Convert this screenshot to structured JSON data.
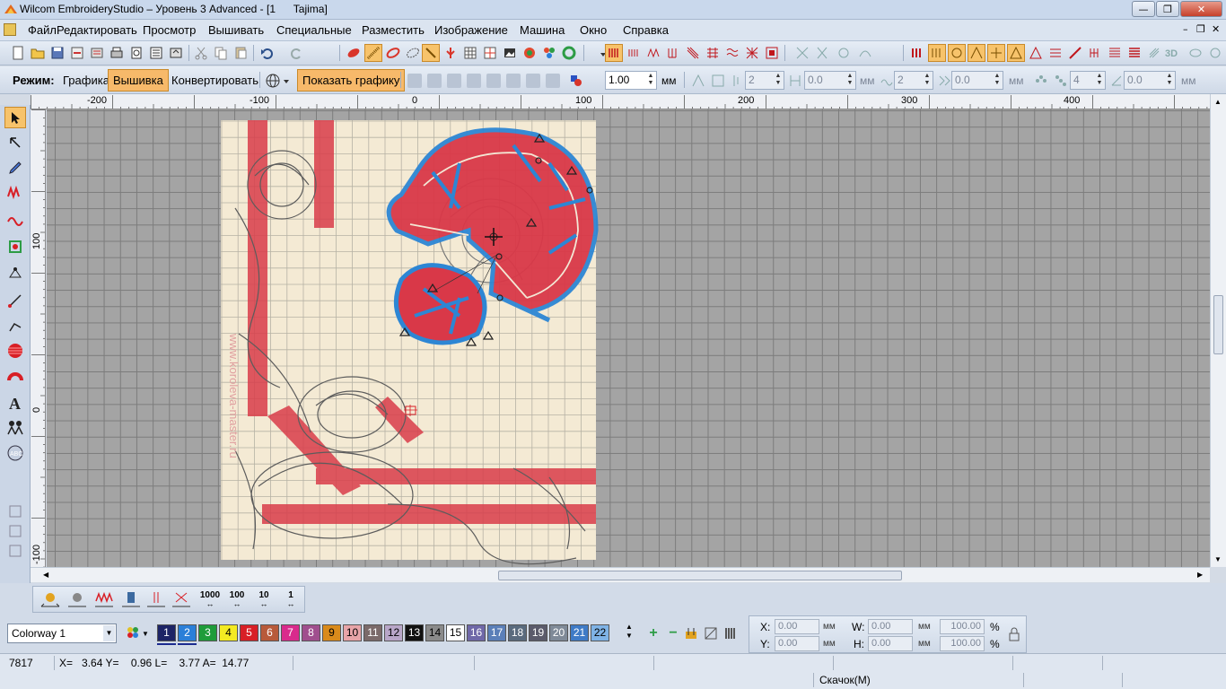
{
  "window": {
    "title": "Wilcom EmbroideryStudio – Уровень 3 Advanced - [1      Tajima]",
    "controls": {
      "minimize": "—",
      "maximize": "❐",
      "close": "✕"
    }
  },
  "menu": {
    "items": [
      "Файл",
      "Редактировать",
      "Просмотр",
      "Вышивать",
      "Специальные",
      "Разместить",
      "Изображение",
      "Машина",
      "Окно",
      "Справка"
    ],
    "mdi_controls": {
      "minimize": "–",
      "restore": "❐",
      "close": "✕"
    }
  },
  "mode_bar": {
    "label": "Режим:",
    "modes": [
      "Графика",
      "Вышивка",
      "Конвертировать"
    ],
    "active_mode": "Вышивка",
    "show_graphics_button": "Показать графику",
    "scale_value": "1.00",
    "scale_unit": "мм",
    "fields": [
      {
        "value": "2",
        "unit": ""
      },
      {
        "value": "0.0",
        "unit": "мм"
      },
      {
        "value": "2",
        "unit": ""
      },
      {
        "value": "0.0",
        "unit": "мм"
      },
      {
        "value": "4",
        "unit": ""
      },
      {
        "value": "0.0",
        "unit": "мм"
      }
    ]
  },
  "ruler": {
    "top_labels": [
      "-200",
      "-100",
      "0",
      "100",
      "200",
      "300",
      "400"
    ],
    "left_labels": [
      "100",
      "0",
      "-100"
    ]
  },
  "stitch_toolbar": {
    "numeric_buttons": [
      "1000",
      "100",
      "10",
      "1"
    ]
  },
  "colorway": {
    "selected": "Colorway 1",
    "swatches": [
      {
        "n": "1",
        "bg": "#1d2466",
        "fg": "#ffffff"
      },
      {
        "n": "2",
        "bg": "#2b7fd8",
        "fg": "#ffffff"
      },
      {
        "n": "3",
        "bg": "#1f9c3a",
        "fg": "#ffffff"
      },
      {
        "n": "4",
        "bg": "#f3ea22",
        "fg": "#000000"
      },
      {
        "n": "5",
        "bg": "#d81f26",
        "fg": "#ffffff"
      },
      {
        "n": "6",
        "bg": "#b85a3a",
        "fg": "#ffffff"
      },
      {
        "n": "7",
        "bg": "#d92a8c",
        "fg": "#ffffff"
      },
      {
        "n": "8",
        "bg": "#a04e8e",
        "fg": "#ffffff"
      },
      {
        "n": "9",
        "bg": "#d98a1b",
        "fg": "#000000"
      },
      {
        "n": "10",
        "bg": "#e7a4a8",
        "fg": "#000000"
      },
      {
        "n": "11",
        "bg": "#7b6a6a",
        "fg": "#ffffff"
      },
      {
        "n": "12",
        "bg": "#b8a6c8",
        "fg": "#000000"
      },
      {
        "n": "13",
        "bg": "#111111",
        "fg": "#ffffff"
      },
      {
        "n": "14",
        "bg": "#8a8a8a",
        "fg": "#000000"
      },
      {
        "n": "15",
        "bg": "#ffffff",
        "fg": "#000000"
      },
      {
        "n": "16",
        "bg": "#6f68a8",
        "fg": "#ffffff"
      },
      {
        "n": "17",
        "bg": "#5b7fb8",
        "fg": "#ffffff"
      },
      {
        "n": "18",
        "bg": "#5a6b7e",
        "fg": "#ffffff"
      },
      {
        "n": "19",
        "bg": "#5b5b6b",
        "fg": "#ffffff"
      },
      {
        "n": "20",
        "bg": "#7f8a98",
        "fg": "#ffffff"
      },
      {
        "n": "21",
        "bg": "#3f7bc6",
        "fg": "#ffffff"
      },
      {
        "n": "22",
        "bg": "#7fb3e6",
        "fg": "#000000"
      }
    ]
  },
  "coords": {
    "x_label": "X:",
    "y_label": "Y:",
    "w_label": "W:",
    "h_label": "H:",
    "x": "0.00",
    "y": "0.00",
    "w": "0.00",
    "h": "0.00",
    "unit": "мм",
    "w_pct": "100.00",
    "h_pct": "100.00",
    "pct": "%"
  },
  "status": {
    "stitch_count": "7817",
    "cursor": "X=   3.64 Y=    0.96 L=    3.77 A=  14.77",
    "hint": "Скачок(M)"
  }
}
